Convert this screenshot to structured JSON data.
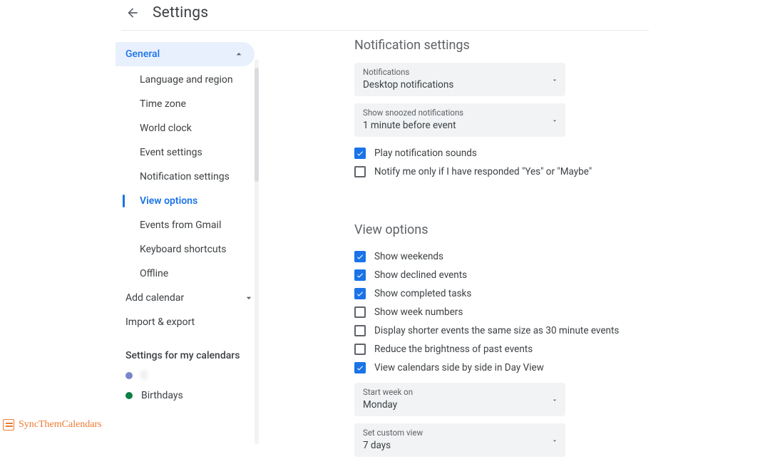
{
  "header": {
    "title": "Settings"
  },
  "sidebar": {
    "general_label": "General",
    "items": [
      {
        "label": "Language and region"
      },
      {
        "label": "Time zone"
      },
      {
        "label": "World clock"
      },
      {
        "label": "Event settings"
      },
      {
        "label": "Notification settings"
      },
      {
        "label": "View options"
      },
      {
        "label": "Events from Gmail"
      },
      {
        "label": "Keyboard shortcuts"
      },
      {
        "label": "Offline"
      }
    ],
    "add_calendar": "Add calendar",
    "import_export": "Import & export",
    "my_calendars_heading": "Settings for my calendars",
    "calendars": [
      {
        "label": "C",
        "color": "#7986cb"
      },
      {
        "label": "Birthdays",
        "color": "#0b8043"
      }
    ]
  },
  "notifications": {
    "title": "Notification settings",
    "select1_label": "Notifications",
    "select1_value": "Desktop notifications",
    "select2_label": "Show snoozed notifications",
    "select2_value": "1 minute before event",
    "check_sounds": "Play notification sounds",
    "check_notify_if_responded": "Notify me only if I have responded \"Yes\" or \"Maybe\""
  },
  "view": {
    "title": "View options",
    "checks": [
      {
        "label": "Show weekends",
        "checked": true
      },
      {
        "label": "Show declined events",
        "checked": true
      },
      {
        "label": "Show completed tasks",
        "checked": true
      },
      {
        "label": "Show week numbers",
        "checked": false
      },
      {
        "label": "Display shorter events the same size as 30 minute events",
        "checked": false
      },
      {
        "label": "Reduce the brightness of past events",
        "checked": false
      },
      {
        "label": "View calendars side by side in Day View",
        "checked": true
      }
    ],
    "select1_label": "Start week on",
    "select1_value": "Monday",
    "select2_label": "Set custom view",
    "select2_value": "7 days"
  },
  "watermark": "SyncThemCalendars"
}
